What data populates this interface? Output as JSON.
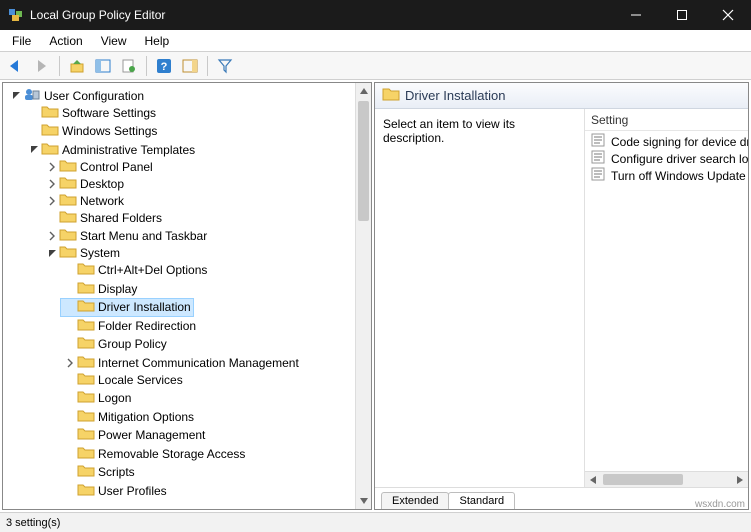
{
  "window": {
    "title": "Local Group Policy Editor",
    "buttons": {
      "minimize": "minimize",
      "maximize": "maximize",
      "close": "close"
    }
  },
  "menubar": [
    "File",
    "Action",
    "View",
    "Help"
  ],
  "toolbar_icons": [
    "back",
    "forward",
    "up",
    "show-hide-tree",
    "new-window",
    "export",
    "help",
    "show-hide-action",
    "filter"
  ],
  "tree": {
    "root": {
      "label": "User Configuration",
      "children": [
        {
          "label": "Software Settings"
        },
        {
          "label": "Windows Settings"
        },
        {
          "label": "Administrative Templates",
          "expanded": true,
          "children": [
            {
              "label": "Control Panel",
              "hasChildren": true
            },
            {
              "label": "Desktop",
              "hasChildren": true
            },
            {
              "label": "Network",
              "hasChildren": true
            },
            {
              "label": "Shared Folders"
            },
            {
              "label": "Start Menu and Taskbar",
              "hasChildren": true
            },
            {
              "label": "System",
              "expanded": true,
              "children": [
                {
                  "label": "Ctrl+Alt+Del Options"
                },
                {
                  "label": "Display"
                },
                {
                  "label": "Driver Installation",
                  "selected": true
                },
                {
                  "label": "Folder Redirection"
                },
                {
                  "label": "Group Policy"
                },
                {
                  "label": "Internet Communication Management",
                  "hasChildren": true
                },
                {
                  "label": "Locale Services"
                },
                {
                  "label": "Logon"
                },
                {
                  "label": "Mitigation Options"
                },
                {
                  "label": "Power Management"
                },
                {
                  "label": "Removable Storage Access"
                },
                {
                  "label": "Scripts"
                },
                {
                  "label": "User Profiles"
                }
              ]
            }
          ]
        }
      ]
    }
  },
  "detail": {
    "header": "Driver Installation",
    "description": "Select an item to view its description.",
    "column": "Setting",
    "settings": [
      "Code signing for device dr",
      "Configure driver search lo",
      "Turn off Windows Update"
    ],
    "tabs": [
      "Extended",
      "Standard"
    ],
    "activeTab": 1
  },
  "status": "3 setting(s)",
  "watermark": "wsxdn.com"
}
